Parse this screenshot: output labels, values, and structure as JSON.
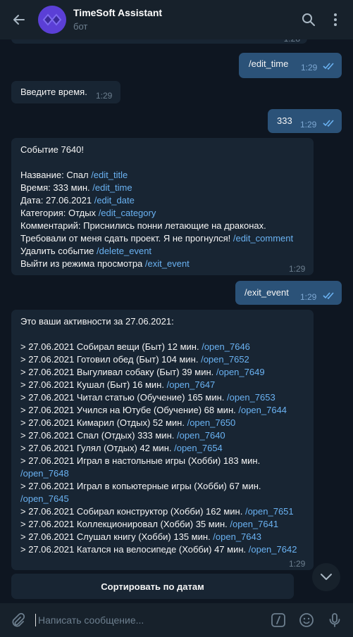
{
  "header": {
    "title": "TimeSoft Assistant",
    "subtitle": "бот"
  },
  "messages": {
    "edit_time_out": {
      "text": "/edit_time",
      "time": "1:29"
    },
    "enter_time": {
      "text": "Введите время.",
      "time": "1:29"
    },
    "out_333": {
      "text": "333",
      "time": "1:29"
    },
    "event": {
      "heading": "Событие 7640!",
      "name_label": "Название: Спал",
      "name_cmd": "/edit_title",
      "time_label": "Время: 333 мин.",
      "time_cmd": "/edit_time",
      "date_label": "Дата: 27.06.2021",
      "date_cmd": "/edit_date",
      "cat_label": "Категория: Отдых",
      "cat_cmd": "/edit_category",
      "comment_line1": "Комментарий: Приснились понни летающие на драконах.",
      "comment_line2": "Требовали от меня сдать проект. Я не прогнулся!",
      "comment_cmd": "/edit_comment",
      "delete_label": "Удалить событие",
      "delete_cmd": "/delete_event",
      "exit_label": "Выйти из режима просмотра",
      "exit_cmd": "/exit_event",
      "time": "1:29"
    },
    "exit_event_out": {
      "text": "/exit_event",
      "time": "1:29"
    },
    "activities": {
      "heading": "Это ваши активности за 27.06.2021:",
      "items": [
        {
          "text": ">  27.06.2021 Собирал вещи (Быт) 12 мин.",
          "cmd": "/open_7646"
        },
        {
          "text": ">  27.06.2021 Готовил обед (Быт) 104 мин.",
          "cmd": "/open_7652"
        },
        {
          "text": ">  27.06.2021 Выгуливал собаку (Быт) 39 мин.",
          "cmd": "/open_7649"
        },
        {
          "text": ">  27.06.2021 Кушал (Быт) 16 мин.",
          "cmd": "/open_7647"
        },
        {
          "text": ">  27.06.2021 Читал статью (Обучение) 165 мин.",
          "cmd": "/open_7653"
        },
        {
          "text": ">  27.06.2021 Учился на Ютубе (Обучение) 68 мин.",
          "cmd": "/open_7644"
        },
        {
          "text": ">  27.06.2021 Кимарил (Отдых) 52 мин.",
          "cmd": "/open_7650"
        },
        {
          "text": ">  27.06.2021 Спал (Отдых) 333 мин.",
          "cmd": "/open_7640"
        },
        {
          "text": ">  27.06.2021 Гулял (Отдых) 42 мин.",
          "cmd": "/open_7654"
        },
        {
          "text": ">  27.06.2021 Играл в настольные игры (Хобби) 183 мин.",
          "cmd": "/open_7648"
        },
        {
          "text": ">  27.06.2021 Играл в копьютерные игры (Хобби) 67 мин.",
          "cmd": "/open_7645"
        },
        {
          "text": ">  27.06.2021 Собирал конструктор (Хобби) 162 мин.",
          "cmd": "/open_7651"
        },
        {
          "text": ">  27.06.2021 Коллекционировал (Хобби) 35 мин.",
          "cmd": "/open_7641"
        },
        {
          "text": ">  27.06.2021 Слушал книгу (Хобби) 135 мин.",
          "cmd": "/open_7643"
        },
        {
          "text": ">  27.06.2021 Катался на велосипеде (Хобби) 47 мин.",
          "cmd": "/open_7642"
        }
      ],
      "time": "1:29"
    }
  },
  "keyboard": {
    "button_label": "Сортировать по датам"
  },
  "input": {
    "placeholder": "Написать сообщение..."
  },
  "icons": {
    "back": "arrow-left-icon",
    "avatar": "timesoft-logo-icon",
    "search": "search-icon",
    "menu": "more-vertical-icon",
    "attach": "paperclip-icon",
    "commands": "bot-commands-icon",
    "emoji": "emoji-icon",
    "mic": "microphone-icon",
    "scroll": "chevron-down-icon",
    "read": "double-check-icon"
  },
  "colors": {
    "background": "#0e1621",
    "header": "#17212b",
    "incoming": "#182533",
    "outgoing": "#2b5278",
    "link": "#6ab2f2"
  }
}
